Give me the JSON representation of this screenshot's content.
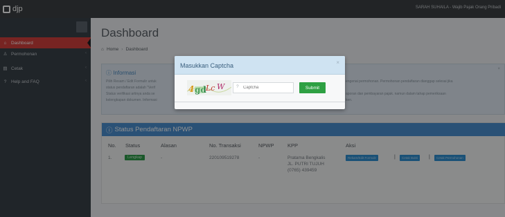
{
  "topbar": {
    "app_name": "djp",
    "user_text": "SARAH SUHAILA - Wajib Pajak Orang Pribadi"
  },
  "sidebar": {
    "items": [
      {
        "label": "Dashboard",
        "icon": "home-icon",
        "glyph": "⌂",
        "active": true
      },
      {
        "label": "Permohonan",
        "icon": "user-icon",
        "glyph": "♙",
        "active": false
      },
      {
        "label": "Cetak",
        "icon": "print-icon",
        "glyph": "▤",
        "active": false
      },
      {
        "label": "Help and FAQ",
        "icon": "question-icon",
        "glyph": "?",
        "active": false
      }
    ]
  },
  "main": {
    "title": "Dashboard",
    "breadcrumb": [
      "Home",
      "Dashboard"
    ]
  },
  "info": {
    "title": "Informasi",
    "line1": "Pilih Resam / Edit Formulir untuk",
    "line2": "status pendaftaran adalah \"Verif",
    "line3": "Status verifikasi artinya anda se",
    "line4": "kelengkapan dokumen. Informasi",
    "right1": "engenai permohonan. Permohonan pendaftaran dianggap selesai jika",
    "right2": "aporan dan pembayaran pajak. namun dalam tahap pemeriksaan",
    "right3": "ken."
  },
  "status_panel": {
    "title": "Status Pendaftaran NPWP",
    "columns": [
      "No.",
      "Status",
      "Alasan",
      "No. Transaksi",
      "NPWP",
      "KPP",
      "Aksi"
    ],
    "rows": [
      {
        "no": "1.",
        "status": "Lengkap",
        "alasan": "-",
        "transaksi": "220109519278",
        "npwp": "-",
        "kpp_line1": "Pratama Bengkalis",
        "kpp_line2": "JL. PUTRI TUJUH",
        "kpp_line3": "(0765) 439459",
        "actions": [
          "Rekam/Edit Formulir",
          "Cetak Bukti",
          "Cetak Permohonan"
        ]
      }
    ]
  },
  "modal": {
    "title": "Masukkan Captcha",
    "close_glyph": "×",
    "captcha_text": "4gdLcW",
    "input_placeholder": "Captcha",
    "submit_label": "Submit"
  },
  "colors": {
    "topbar": "#3c4043",
    "sidebar": "#394148",
    "sidebar_active": "#d2403c",
    "panel_header": "#4a8fd0",
    "submit": "#2ea043",
    "badge": "#2e9b4a",
    "action": "#2f8fd2"
  }
}
